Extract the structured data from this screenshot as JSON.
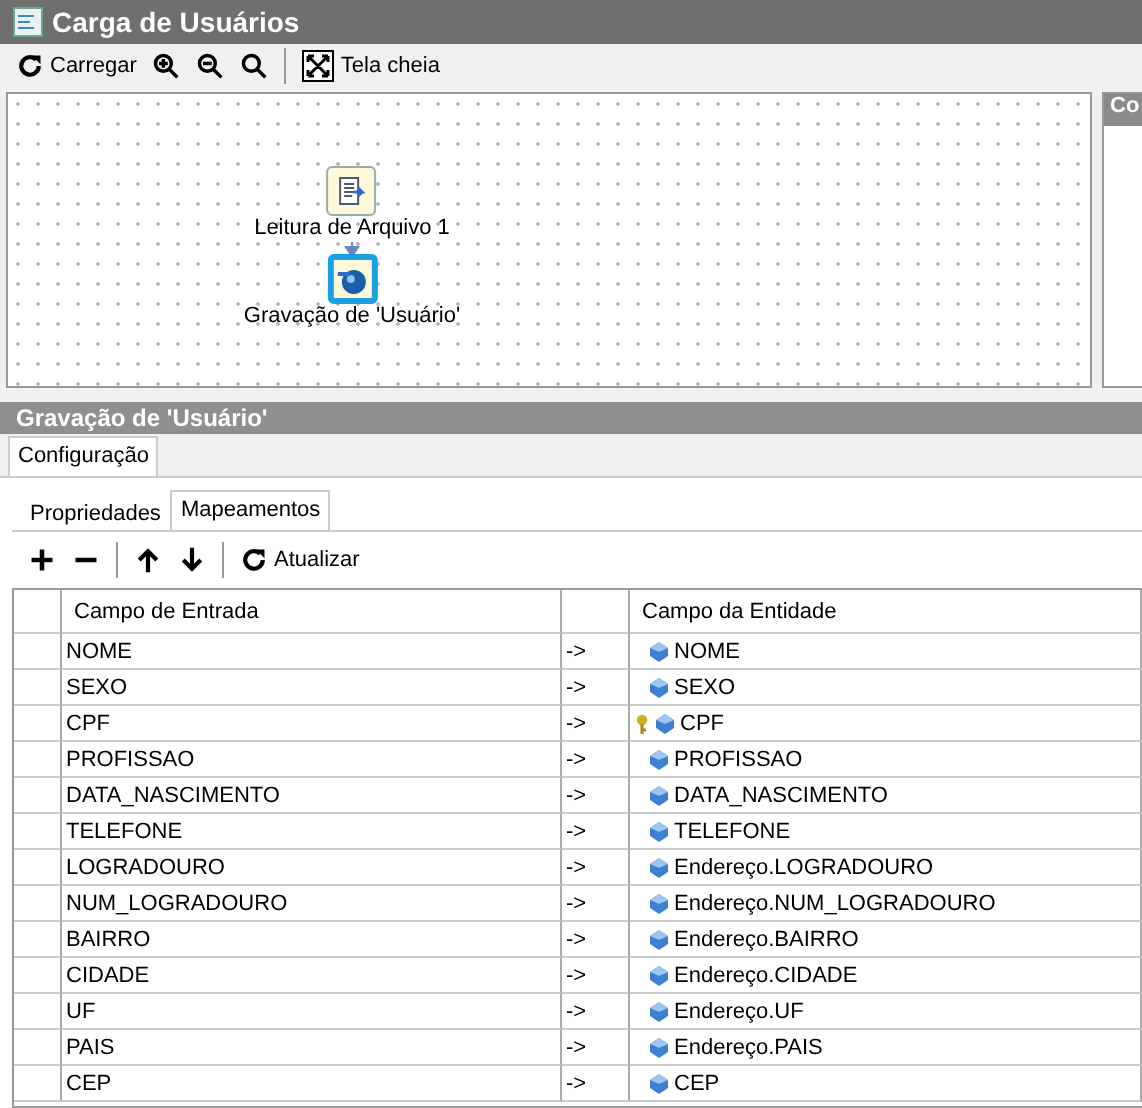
{
  "window": {
    "title": "Carga de Usuários"
  },
  "toolbar": [
    {
      "kind": "reload",
      "label": "Carregar"
    },
    {
      "kind": "zoom-in"
    },
    {
      "kind": "zoom-out"
    },
    {
      "kind": "zoom-fit"
    },
    {
      "kind": "fullscreen",
      "label": "Tela cheia"
    }
  ],
  "diagram": {
    "nodes": [
      {
        "label": "Leitura de Arquivo 1",
        "kind": "file",
        "selected": false
      },
      {
        "label": "Gravação de 'Usuário'",
        "kind": "save",
        "selected": true
      }
    ]
  },
  "side_panel": {
    "title": "Co"
  },
  "panel": {
    "title": "Gravação de 'Usuário'",
    "tabs": [
      {
        "label": "Configuração",
        "selected": true
      }
    ],
    "subtabs": [
      {
        "label": "Propriedades",
        "selected": false
      },
      {
        "label": "Mapeamentos",
        "selected": true
      }
    ],
    "toolbar": [
      {
        "kind": "add"
      },
      {
        "kind": "remove"
      },
      {
        "kind": "up"
      },
      {
        "kind": "down"
      },
      {
        "kind": "reload",
        "label": "Atualizar"
      }
    ]
  },
  "table": {
    "columns": [
      "Campo de Entrada",
      "Campo da Entidade"
    ],
    "rows": [
      {
        "input": "NOME",
        "arrow": "->",
        "entity": "NOME",
        "key": false
      },
      {
        "input": "SEXO",
        "arrow": "->",
        "entity": "SEXO",
        "key": false
      },
      {
        "input": "CPF",
        "arrow": "->",
        "entity": "CPF",
        "key": true
      },
      {
        "input": "PROFISSAO",
        "arrow": "->",
        "entity": "PROFISSAO",
        "key": false
      },
      {
        "input": "DATA_NASCIMENTO",
        "arrow": "->",
        "entity": "DATA_NASCIMENTO",
        "key": false
      },
      {
        "input": "TELEFONE",
        "arrow": "->",
        "entity": "TELEFONE",
        "key": false
      },
      {
        "input": "LOGRADOURO",
        "arrow": "->",
        "entity": "Endereço.LOGRADOURO",
        "key": false
      },
      {
        "input": "NUM_LOGRADOURO",
        "arrow": "->",
        "entity": "Endereço.NUM_LOGRADOURO",
        "key": false
      },
      {
        "input": "BAIRRO",
        "arrow": "->",
        "entity": "Endereço.BAIRRO",
        "key": false
      },
      {
        "input": "CIDADE",
        "arrow": "->",
        "entity": "Endereço.CIDADE",
        "key": false
      },
      {
        "input": "UF",
        "arrow": "->",
        "entity": "Endereço.UF",
        "key": false
      },
      {
        "input": "PAIS",
        "arrow": "->",
        "entity": "Endereço.PAIS",
        "key": false
      },
      {
        "input": "CEP",
        "arrow": "->",
        "entity": "CEP",
        "key": false
      }
    ]
  }
}
